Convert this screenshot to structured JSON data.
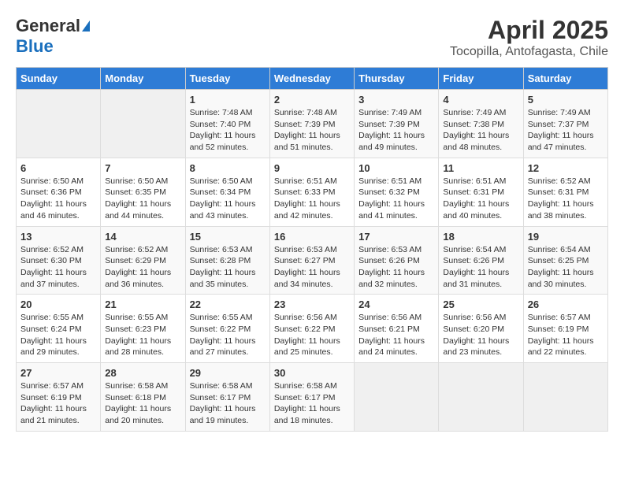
{
  "logo": {
    "general": "General",
    "blue": "Blue"
  },
  "title": {
    "month": "April 2025",
    "location": "Tocopilla, Antofagasta, Chile"
  },
  "calendar": {
    "headers": [
      "Sunday",
      "Monday",
      "Tuesday",
      "Wednesday",
      "Thursday",
      "Friday",
      "Saturday"
    ],
    "weeks": [
      [
        {
          "day": "",
          "info": ""
        },
        {
          "day": "",
          "info": ""
        },
        {
          "day": "1",
          "info": "Sunrise: 7:48 AM\nSunset: 7:40 PM\nDaylight: 11 hours and 52 minutes."
        },
        {
          "day": "2",
          "info": "Sunrise: 7:48 AM\nSunset: 7:39 PM\nDaylight: 11 hours and 51 minutes."
        },
        {
          "day": "3",
          "info": "Sunrise: 7:49 AM\nSunset: 7:39 PM\nDaylight: 11 hours and 49 minutes."
        },
        {
          "day": "4",
          "info": "Sunrise: 7:49 AM\nSunset: 7:38 PM\nDaylight: 11 hours and 48 minutes."
        },
        {
          "day": "5",
          "info": "Sunrise: 7:49 AM\nSunset: 7:37 PM\nDaylight: 11 hours and 47 minutes."
        }
      ],
      [
        {
          "day": "6",
          "info": "Sunrise: 6:50 AM\nSunset: 6:36 PM\nDaylight: 11 hours and 46 minutes."
        },
        {
          "day": "7",
          "info": "Sunrise: 6:50 AM\nSunset: 6:35 PM\nDaylight: 11 hours and 44 minutes."
        },
        {
          "day": "8",
          "info": "Sunrise: 6:50 AM\nSunset: 6:34 PM\nDaylight: 11 hours and 43 minutes."
        },
        {
          "day": "9",
          "info": "Sunrise: 6:51 AM\nSunset: 6:33 PM\nDaylight: 11 hours and 42 minutes."
        },
        {
          "day": "10",
          "info": "Sunrise: 6:51 AM\nSunset: 6:32 PM\nDaylight: 11 hours and 41 minutes."
        },
        {
          "day": "11",
          "info": "Sunrise: 6:51 AM\nSunset: 6:31 PM\nDaylight: 11 hours and 40 minutes."
        },
        {
          "day": "12",
          "info": "Sunrise: 6:52 AM\nSunset: 6:31 PM\nDaylight: 11 hours and 38 minutes."
        }
      ],
      [
        {
          "day": "13",
          "info": "Sunrise: 6:52 AM\nSunset: 6:30 PM\nDaylight: 11 hours and 37 minutes."
        },
        {
          "day": "14",
          "info": "Sunrise: 6:52 AM\nSunset: 6:29 PM\nDaylight: 11 hours and 36 minutes."
        },
        {
          "day": "15",
          "info": "Sunrise: 6:53 AM\nSunset: 6:28 PM\nDaylight: 11 hours and 35 minutes."
        },
        {
          "day": "16",
          "info": "Sunrise: 6:53 AM\nSunset: 6:27 PM\nDaylight: 11 hours and 34 minutes."
        },
        {
          "day": "17",
          "info": "Sunrise: 6:53 AM\nSunset: 6:26 PM\nDaylight: 11 hours and 32 minutes."
        },
        {
          "day": "18",
          "info": "Sunrise: 6:54 AM\nSunset: 6:26 PM\nDaylight: 11 hours and 31 minutes."
        },
        {
          "day": "19",
          "info": "Sunrise: 6:54 AM\nSunset: 6:25 PM\nDaylight: 11 hours and 30 minutes."
        }
      ],
      [
        {
          "day": "20",
          "info": "Sunrise: 6:55 AM\nSunset: 6:24 PM\nDaylight: 11 hours and 29 minutes."
        },
        {
          "day": "21",
          "info": "Sunrise: 6:55 AM\nSunset: 6:23 PM\nDaylight: 11 hours and 28 minutes."
        },
        {
          "day": "22",
          "info": "Sunrise: 6:55 AM\nSunset: 6:22 PM\nDaylight: 11 hours and 27 minutes."
        },
        {
          "day": "23",
          "info": "Sunrise: 6:56 AM\nSunset: 6:22 PM\nDaylight: 11 hours and 25 minutes."
        },
        {
          "day": "24",
          "info": "Sunrise: 6:56 AM\nSunset: 6:21 PM\nDaylight: 11 hours and 24 minutes."
        },
        {
          "day": "25",
          "info": "Sunrise: 6:56 AM\nSunset: 6:20 PM\nDaylight: 11 hours and 23 minutes."
        },
        {
          "day": "26",
          "info": "Sunrise: 6:57 AM\nSunset: 6:19 PM\nDaylight: 11 hours and 22 minutes."
        }
      ],
      [
        {
          "day": "27",
          "info": "Sunrise: 6:57 AM\nSunset: 6:19 PM\nDaylight: 11 hours and 21 minutes."
        },
        {
          "day": "28",
          "info": "Sunrise: 6:58 AM\nSunset: 6:18 PM\nDaylight: 11 hours and 20 minutes."
        },
        {
          "day": "29",
          "info": "Sunrise: 6:58 AM\nSunset: 6:17 PM\nDaylight: 11 hours and 19 minutes."
        },
        {
          "day": "30",
          "info": "Sunrise: 6:58 AM\nSunset: 6:17 PM\nDaylight: 11 hours and 18 minutes."
        },
        {
          "day": "",
          "info": ""
        },
        {
          "day": "",
          "info": ""
        },
        {
          "day": "",
          "info": ""
        }
      ]
    ]
  }
}
